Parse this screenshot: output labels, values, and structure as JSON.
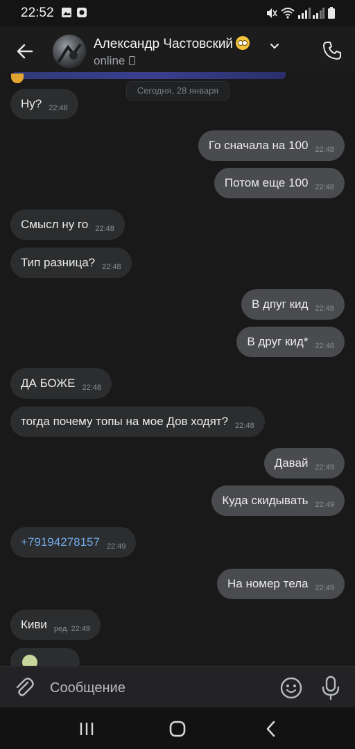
{
  "status_bar": {
    "time": "22:52"
  },
  "header": {
    "contact_name": "Александр Частовский",
    "contact_status": "online"
  },
  "chat": {
    "date_separator": "Сегодня, 28 января",
    "messages": [
      {
        "dir": "in",
        "text": "Ну?",
        "time": "22:48"
      },
      {
        "dir": "out",
        "text": "Го сначала на 100",
        "time": "22:48"
      },
      {
        "dir": "out",
        "text": "Потом еще 100",
        "time": "22:48"
      },
      {
        "dir": "in",
        "text": "Смысл ну го",
        "time": "22:48"
      },
      {
        "dir": "in",
        "text": "Тип разница?",
        "time": "22:48"
      },
      {
        "dir": "out",
        "text": "В дпуг кид",
        "time": "22:48"
      },
      {
        "dir": "out",
        "text": "В друг кид*",
        "time": "22:48"
      },
      {
        "dir": "in",
        "text": "ДА БОЖЕ",
        "time": "22:48"
      },
      {
        "dir": "in",
        "text": "тогда почему топы на мое Дов ходят?",
        "time": "22:48"
      },
      {
        "dir": "out",
        "text": "Давай",
        "time": "22:49"
      },
      {
        "dir": "out",
        "text": "Куда скидывать",
        "time": "22:49"
      },
      {
        "dir": "in",
        "text": "+79194278157",
        "time": "22:49",
        "link": true
      },
      {
        "dir": "out",
        "text": "На номер тела",
        "time": "22:49"
      },
      {
        "dir": "in",
        "text": "Киви",
        "time": "ред. 22:49"
      }
    ]
  },
  "input": {
    "placeholder": "Сообщение"
  },
  "colors": {
    "background": "#19191a",
    "incoming_bubble": "#2c2d2e",
    "outgoing_bubble": "#4a4b4e",
    "link": "#71aaeb"
  },
  "icons": [
    "back-arrow-icon",
    "chevron-down-icon",
    "phone-icon",
    "attach-icon",
    "emoji-icon",
    "microphone-icon",
    "recents-icon",
    "home-icon",
    "back-nav-icon"
  ]
}
